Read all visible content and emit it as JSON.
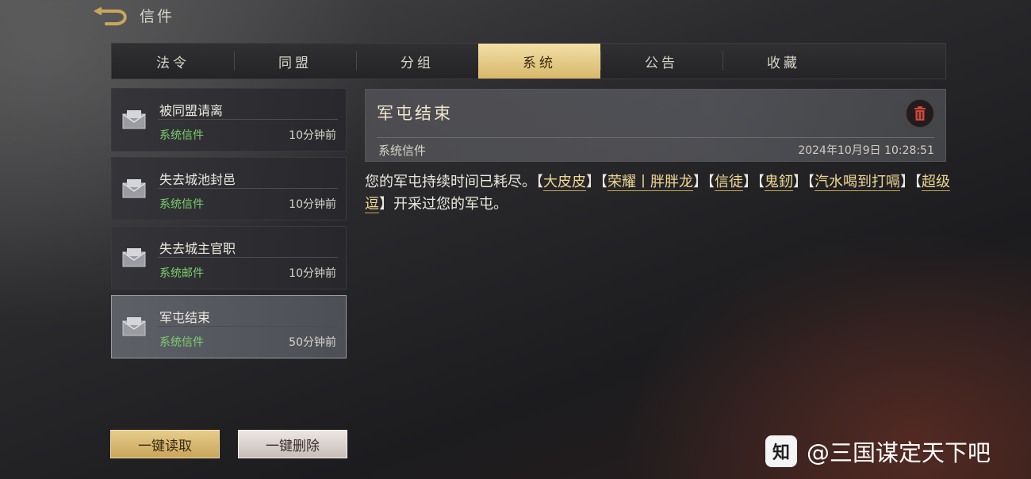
{
  "header": {
    "title": "信件"
  },
  "tabs": [
    {
      "label": "法令",
      "active": false
    },
    {
      "label": "同盟",
      "active": false
    },
    {
      "label": "分组",
      "active": false
    },
    {
      "label": "系统",
      "active": true
    },
    {
      "label": "公告",
      "active": false
    },
    {
      "label": "收藏",
      "active": false
    }
  ],
  "mail_list": [
    {
      "subject": "被同盟请离",
      "type": "系统信件",
      "time": "10分钟前",
      "selected": false
    },
    {
      "subject": "失去城池封邑",
      "type": "系统信件",
      "time": "10分钟前",
      "selected": false
    },
    {
      "subject": "失去城主官职",
      "type": "系统邮件",
      "time": "10分钟前",
      "selected": false
    },
    {
      "subject": "军屯结束",
      "type": "系统信件",
      "time": "50分钟前",
      "selected": true
    }
  ],
  "detail": {
    "title": "军屯结束",
    "type": "系统信件",
    "date": "2024年10月9日 10:28:51",
    "body_prefix": "您的军屯持续时间已耗尽。",
    "players": [
      "大皮皮",
      "荣耀丨胖胖龙",
      "信徒",
      "鬼釰",
      "汽水喝到打嗝",
      "超级逗"
    ],
    "body_suffix": "开采过您的军屯。"
  },
  "actions": {
    "read_all": "一键读取",
    "delete_all": "一键删除"
  },
  "watermark": {
    "icon_text": "知",
    "text": "@三国谋定天下吧"
  },
  "colors": {
    "accent_gold": "#d8b86b",
    "mail_type_green": "#7ccf6e",
    "player_highlight": "#efd793"
  }
}
